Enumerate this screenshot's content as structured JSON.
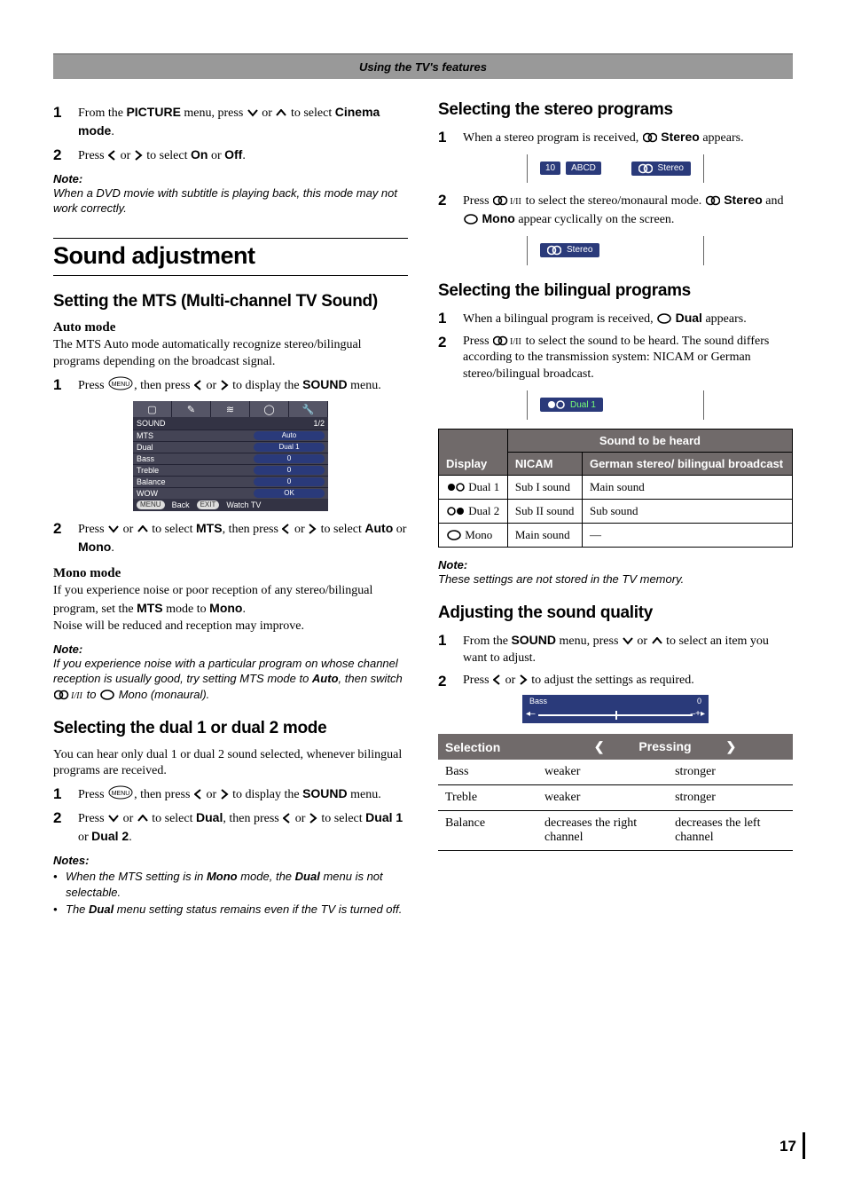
{
  "banner": "Using the TV's features",
  "page_number": "17",
  "left": {
    "cinema": {
      "step1": {
        "n": "1",
        "pre": "From the ",
        "menu": "PICTURE",
        "mid": " menu, press ",
        "tail": " to select ",
        "target": "Cinema mode",
        "end": "."
      },
      "step2": {
        "n": "2",
        "pre": "Press ",
        "mid": " to select ",
        "o1": "On",
        "or": " or ",
        "o2": "Off",
        "end": "."
      },
      "noteLabel": "Note:",
      "noteBody": "When a DVD movie with subtitle is playing back, this mode may not work correctly."
    },
    "soundSection": "Sound adjustment",
    "mts": {
      "h": "Setting the MTS (Multi-channel TV Sound)",
      "autoH": "Auto mode",
      "autoP": "The MTS Auto mode automatically recognize stereo/bilingual programs depending on the broadcast signal.",
      "step1": {
        "n": "1",
        "pre": "Press ",
        "mid": ", then press ",
        "mid2": " to display the ",
        "target": "SOUND",
        "end": " menu."
      },
      "osd": {
        "title": "SOUND",
        "page": "1/2",
        "rows": [
          {
            "k": "MTS",
            "v": "Auto"
          },
          {
            "k": "Dual",
            "v": "Dual 1"
          },
          {
            "k": "Bass",
            "v": "0"
          },
          {
            "k": "Treble",
            "v": "0"
          },
          {
            "k": "Balance",
            "v": "0"
          },
          {
            "k": "WOW",
            "v": "OK"
          }
        ],
        "foot": {
          "menu": "MENU",
          "back": "Back",
          "exit": "EXIT",
          "watch": "Watch TV"
        }
      },
      "step2": {
        "n": "2",
        "pre": "Press ",
        "mid": " to select ",
        "t1": "MTS",
        "mid2": ", then press ",
        "mid3": " to select ",
        "o1": "Auto",
        "or": " or ",
        "o2": "Mono",
        "end": "."
      },
      "monoH": "Mono mode",
      "monoP1": "If you experience noise or poor reception of any stereo/bilingual program, set the ",
      "monoP1b": "MTS",
      "monoP1c": " mode to ",
      "monoP1d": "Mono",
      "monoP1e": ".",
      "monoP2": "Noise will be reduced and reception may improve.",
      "noteLabel": "Note:",
      "noteBody1": "If you experience noise with a particular program on whose channel reception is usually good, try setting MTS mode to ",
      "noteBody1b": "Auto",
      "noteBody1c": ", then switch ",
      "noteBody1d": " to ",
      "noteBody1e": " Mono (monaural)."
    },
    "dual": {
      "h": "Selecting the dual 1 or dual 2 mode",
      "p": "You can hear only dual 1 or dual 2 sound selected, whenever bilingual programs are received.",
      "step1": {
        "n": "1",
        "pre": "Press ",
        "mid": ", then press ",
        "mid2": " to display the ",
        "target": "SOUND",
        "end": " menu."
      },
      "step2": {
        "n": "2",
        "pre": "Press ",
        "mid": " to select ",
        "t1": "Dual",
        "mid2": ", then press ",
        "mid3": " to select ",
        "o1": "Dual 1",
        "or": " or ",
        "o2": "Dual 2",
        "end": "."
      },
      "notesLabel": "Notes:",
      "note1a": "When the MTS setting is in ",
      "note1b": "Mono",
      "note1c": " mode, the ",
      "note1d": "Dual",
      "note1e": " menu is not selectable.",
      "note2a": "The ",
      "note2b": "Dual",
      "note2c": " menu setting status remains even if the TV is turned off."
    }
  },
  "right": {
    "stereo": {
      "h": "Selecting the stereo programs",
      "step1": {
        "n": "1",
        "pre": "When a stereo program is received, ",
        "t": "Stereo",
        "end": " appears."
      },
      "osd1": {
        "ch": "10",
        "name": "ABCD",
        "label": "Stereo"
      },
      "step2": {
        "n": "2",
        "pre": "Press ",
        "mid": " to select the stereo/monaural mode. ",
        "t1": "Stereo",
        "and": " and ",
        "t2": "Mono",
        "end": " appear cyclically on the screen."
      },
      "osd2": {
        "label": "Stereo"
      }
    },
    "biling": {
      "h": "Selecting the bilingual programs",
      "step1": {
        "n": "1",
        "pre": "When a bilingual program is received, ",
        "t": "Dual",
        "end": " appears."
      },
      "step2": {
        "n": "2",
        "pre": "Press ",
        "mid": " to select the sound to be heard. The sound differs according to the transmission system: NICAM or German stereo/bilingual broadcast."
      },
      "osd": {
        "label": "Dual 1"
      },
      "table": {
        "headDisplay": "Display",
        "headSound": "Sound to be heard",
        "headNicam": "NICAM",
        "headGerman": "German stereo/ bilingual broadcast",
        "rows": [
          {
            "d": "Dual 1",
            "n": "Sub I sound",
            "g": "Main sound",
            "ico": "d1"
          },
          {
            "d": "Dual 2",
            "n": "Sub II sound",
            "g": "Sub sound",
            "ico": "d2"
          },
          {
            "d": "Mono",
            "n": "Main sound",
            "g": "—",
            "ico": "mono"
          }
        ]
      },
      "noteLabel": "Note:",
      "noteBody": "These settings are not stored in the TV memory."
    },
    "quality": {
      "h": "Adjusting the sound quality",
      "step1": {
        "n": "1",
        "pre": "From the ",
        "menu": "SOUND",
        "mid": " menu, press ",
        "tail": " to select an item you want to adjust."
      },
      "step2": {
        "n": "2",
        "pre": "Press ",
        "mid": " to adjust the settings as required."
      },
      "osd": {
        "label": "Bass",
        "val": "0"
      },
      "table": {
        "headSel": "Selection",
        "headPress": "Pressing",
        "rows": [
          {
            "s": "Bass",
            "l": "weaker",
            "r": "stronger"
          },
          {
            "s": "Treble",
            "l": "weaker",
            "r": "stronger"
          },
          {
            "s": "Balance",
            "l": "decreases the right channel",
            "r": "decreases the left channel"
          }
        ]
      }
    }
  }
}
